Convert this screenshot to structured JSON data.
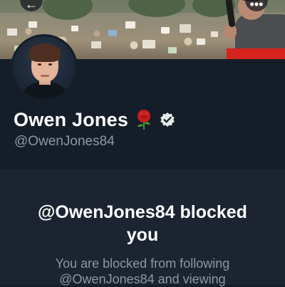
{
  "header": {
    "back_icon": "arrow-left-icon",
    "more_icon": "more-horizontal-icon"
  },
  "profile": {
    "display_name": "Owen Jones",
    "emoji_icon": "rose-icon",
    "verified_icon": "verified-badge-icon",
    "handle": "@OwenJones84"
  },
  "blocked_notice": {
    "title_line1": "@OwenJones84 blocked",
    "title_line2": "you",
    "subtitle_line1": "You are blocked from following",
    "subtitle_line2": "@OwenJones84 and viewing"
  },
  "colors": {
    "background": "#151e28",
    "panel": "#1b2430",
    "secondary_text": "#8b98a5",
    "primary_text": "#ffffff",
    "rose": "#d0201f"
  }
}
